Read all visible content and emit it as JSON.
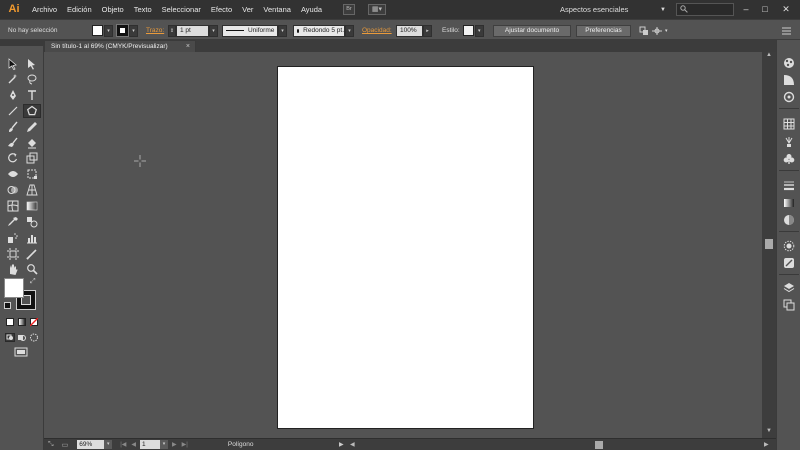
{
  "app": {
    "logo_text": "Ai"
  },
  "menu": {
    "items": [
      "Archivo",
      "Edición",
      "Objeto",
      "Texto",
      "Seleccionar",
      "Efecto",
      "Ver",
      "Ventana",
      "Ayuda"
    ],
    "bridge_label": "Br",
    "workspace": "Aspectos esenciales",
    "search_icon": "search-icon"
  },
  "control": {
    "selection_status": "No hay selección",
    "stroke_label": "Trazo:",
    "stroke_weight": "1 pt",
    "stroke_profile": "Uniforme",
    "brush": "Redondo 5 pt.",
    "opacity_label": "Opacidad:",
    "opacity_value": "100%",
    "style_label": "Estilo:",
    "doc_setup_button": "Ajustar documento",
    "prefs_button": "Preferencias"
  },
  "document": {
    "tab_title": "Sin título-1 al 69% (CMYK/Previsualizar)",
    "tab_close": "×"
  },
  "status": {
    "zoom": "69%",
    "artboard_number": "1",
    "current_tool": "Polígono"
  },
  "colors": {
    "accent_orange": "#e99a3b",
    "chrome_dark": "#323232",
    "panel_bg": "#535353",
    "artboard": "#ffffff"
  }
}
